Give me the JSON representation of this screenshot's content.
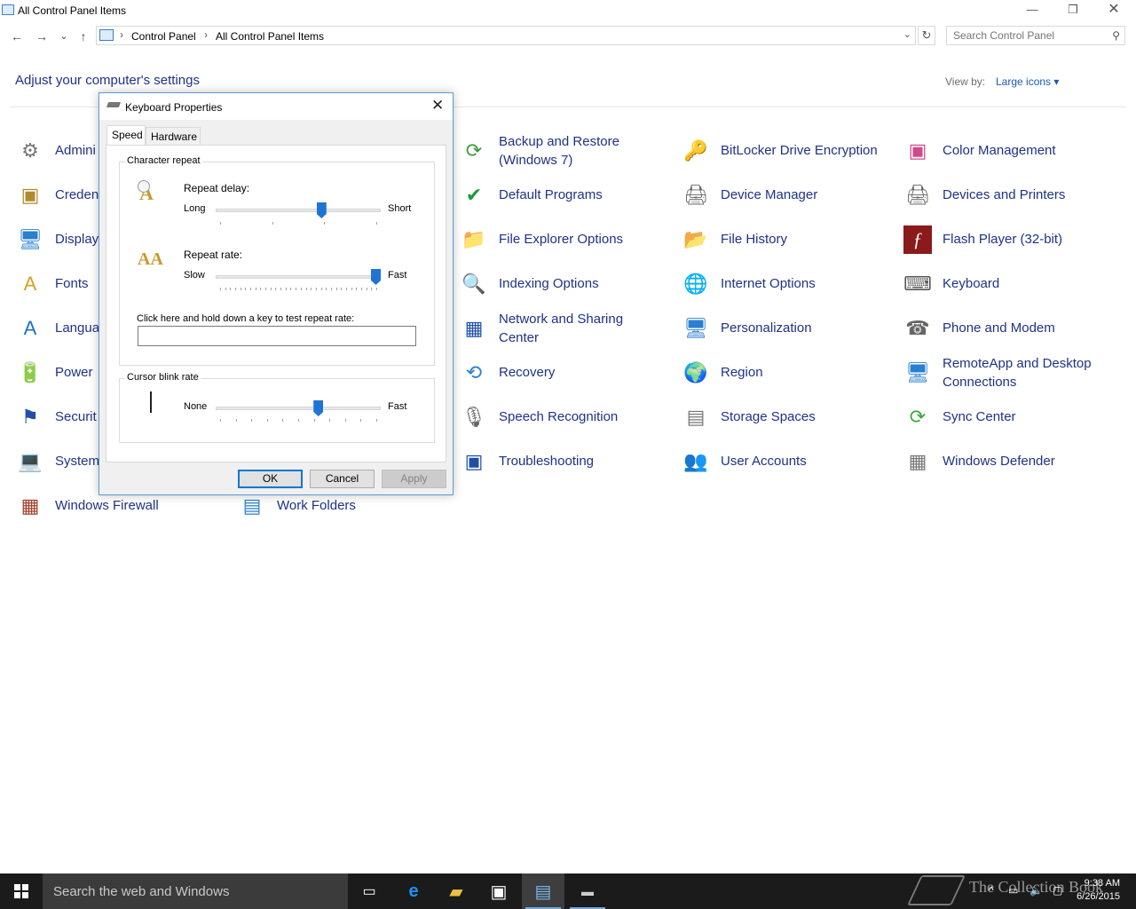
{
  "window": {
    "title": "All Control Panel Items",
    "minimize": "—",
    "restore": "❐",
    "close": "✕"
  },
  "nav": {
    "back": "←",
    "forward": "→",
    "recent": "⌄",
    "up": "↑",
    "breadcrumb": [
      "Control Panel",
      "All Control Panel Items"
    ],
    "refresh": "↻",
    "search_placeholder": "Search Control Panel"
  },
  "header": {
    "title": "Adjust your computer's settings",
    "view_by_label": "View by:",
    "view_by_value": "Large icons ▾"
  },
  "items": [
    {
      "label": "Admini",
      "icon": "administrative-tools-icon",
      "glyph": "⚙",
      "color": "#777777"
    },
    {
      "label": "Creden",
      "icon": "credential-manager-icon",
      "glyph": "▣",
      "color": "#b08a2e"
    },
    {
      "label": "Display",
      "icon": "display-icon",
      "glyph": "🖥",
      "color": "#2a7fd0"
    },
    {
      "label": "Fonts",
      "icon": "fonts-icon",
      "glyph": "A",
      "color": "#d4a020"
    },
    {
      "label": "Langua",
      "icon": "language-icon",
      "glyph": "A",
      "color": "#1f6fc8"
    },
    {
      "label": "Power",
      "icon": "power-options-icon",
      "glyph": "🔋",
      "color": "#3a9a3a"
    },
    {
      "label": "Securit",
      "icon": "security-and-maintenance-icon",
      "glyph": "⚑",
      "color": "#1f4fa8"
    },
    {
      "label": "System",
      "icon": "system-icon",
      "glyph": "💻",
      "color": "#2a7fd0"
    },
    {
      "label": "Windows Firewall",
      "icon": "windows-firewall-icon",
      "glyph": "▦",
      "color": "#a0402a"
    },
    {
      "label": "Work Folders",
      "icon": "work-folders-icon",
      "glyph": "▤",
      "color": "#2a7fd0"
    },
    {
      "label": "Backup and Restore (Windows 7)",
      "icon": "backup-and-restore-icon",
      "glyph": "⟳",
      "color": "#3a9a3a"
    },
    {
      "label": "Default Programs",
      "icon": "default-programs-icon",
      "glyph": "✔",
      "color": "#1e9a3a"
    },
    {
      "label": "File Explorer Options",
      "icon": "file-explorer-options-icon",
      "glyph": "📁",
      "color": "#e2b23a"
    },
    {
      "label": "Indexing Options",
      "icon": "indexing-options-icon",
      "glyph": "🔍",
      "color": "#777777"
    },
    {
      "label": "Network and Sharing Center",
      "icon": "network-and-sharing-icon",
      "glyph": "▦",
      "color": "#1f4fa8"
    },
    {
      "label": "Recovery",
      "icon": "recovery-icon",
      "glyph": "⟲",
      "color": "#2a7fd0"
    },
    {
      "label": "Speech Recognition",
      "icon": "microphone-icon",
      "glyph": "🎙",
      "color": "#666666"
    },
    {
      "label": "Troubleshooting",
      "icon": "troubleshooting-icon",
      "glyph": "▣",
      "color": "#1f4fa8"
    },
    {
      "label": "BitLocker Drive Encryption",
      "icon": "bitlocker-icon",
      "glyph": "🔑",
      "color": "#888888"
    },
    {
      "label": "Device Manager",
      "icon": "device-manager-icon",
      "glyph": "🖨",
      "color": "#666666"
    },
    {
      "label": "File History",
      "icon": "file-history-icon",
      "glyph": "📂",
      "color": "#e2b23a"
    },
    {
      "label": "Internet Options",
      "icon": "internet-options-icon",
      "glyph": "🌐",
      "color": "#2a7fd0"
    },
    {
      "label": "Personalization",
      "icon": "personalization-icon",
      "glyph": "🖥",
      "color": "#2a7fd0"
    },
    {
      "label": "Region",
      "icon": "region-icon",
      "glyph": "🌍",
      "color": "#2a7fd0"
    },
    {
      "label": "Storage Spaces",
      "icon": "storage-spaces-icon",
      "glyph": "▤",
      "color": "#777777"
    },
    {
      "label": "User Accounts",
      "icon": "user-accounts-icon",
      "glyph": "👥",
      "color": "#3a8a3a"
    },
    {
      "label": "Color Management",
      "icon": "color-management-icon",
      "glyph": "▣",
      "color": "#d04a8a"
    },
    {
      "label": "Devices and Printers",
      "icon": "devices-and-printers-icon",
      "glyph": "🖨",
      "color": "#666666"
    },
    {
      "label": "Flash Player (32-bit)",
      "icon": "flash-player-icon",
      "glyph": "ƒ",
      "color": "#ffffff"
    },
    {
      "label": "Keyboard",
      "icon": "keyboard-icon",
      "glyph": "⌨",
      "color": "#555555"
    },
    {
      "label": "Phone and Modem",
      "icon": "phone-and-modem-icon",
      "glyph": "☎",
      "color": "#666666"
    },
    {
      "label": "RemoteApp and Desktop Connections",
      "icon": "remoteapp-icon",
      "glyph": "🖥",
      "color": "#2a7fd0"
    },
    {
      "label": "Sync Center",
      "icon": "sync-center-icon",
      "glyph": "⟳",
      "color": "#3aa83a"
    },
    {
      "label": "Windows Defender",
      "icon": "windows-defender-icon",
      "glyph": "▦",
      "color": "#777777"
    }
  ],
  "dialog": {
    "title": "Keyboard Properties",
    "close": "✕",
    "tabs": [
      "Speed",
      "Hardware"
    ],
    "active_tab": "Speed",
    "character_repeat": {
      "group_label": "Character repeat",
      "repeat_delay_label": "Repeat delay:",
      "repeat_delay_min": "Long",
      "repeat_delay_max": "Short",
      "repeat_delay_value": 0.65,
      "repeat_delay_ticks": 4,
      "repeat_rate_label": "Repeat rate:",
      "repeat_rate_min": "Slow",
      "repeat_rate_max": "Fast",
      "repeat_rate_value": 1.0,
      "repeat_rate_ticks": 32,
      "test_label": "Click here and hold down a key to test repeat rate:",
      "test_value": ""
    },
    "cursor_blink": {
      "group_label": "Cursor blink rate",
      "min": "None",
      "max": "Fast",
      "value": 0.63,
      "ticks": 11
    },
    "buttons": {
      "ok": "OK",
      "cancel": "Cancel",
      "apply": "Apply"
    }
  },
  "taskbar": {
    "search_placeholder": "Search the web and Windows",
    "time": "9:38 AM",
    "date": "6/26/2015",
    "watermark": "The Collection Book"
  }
}
